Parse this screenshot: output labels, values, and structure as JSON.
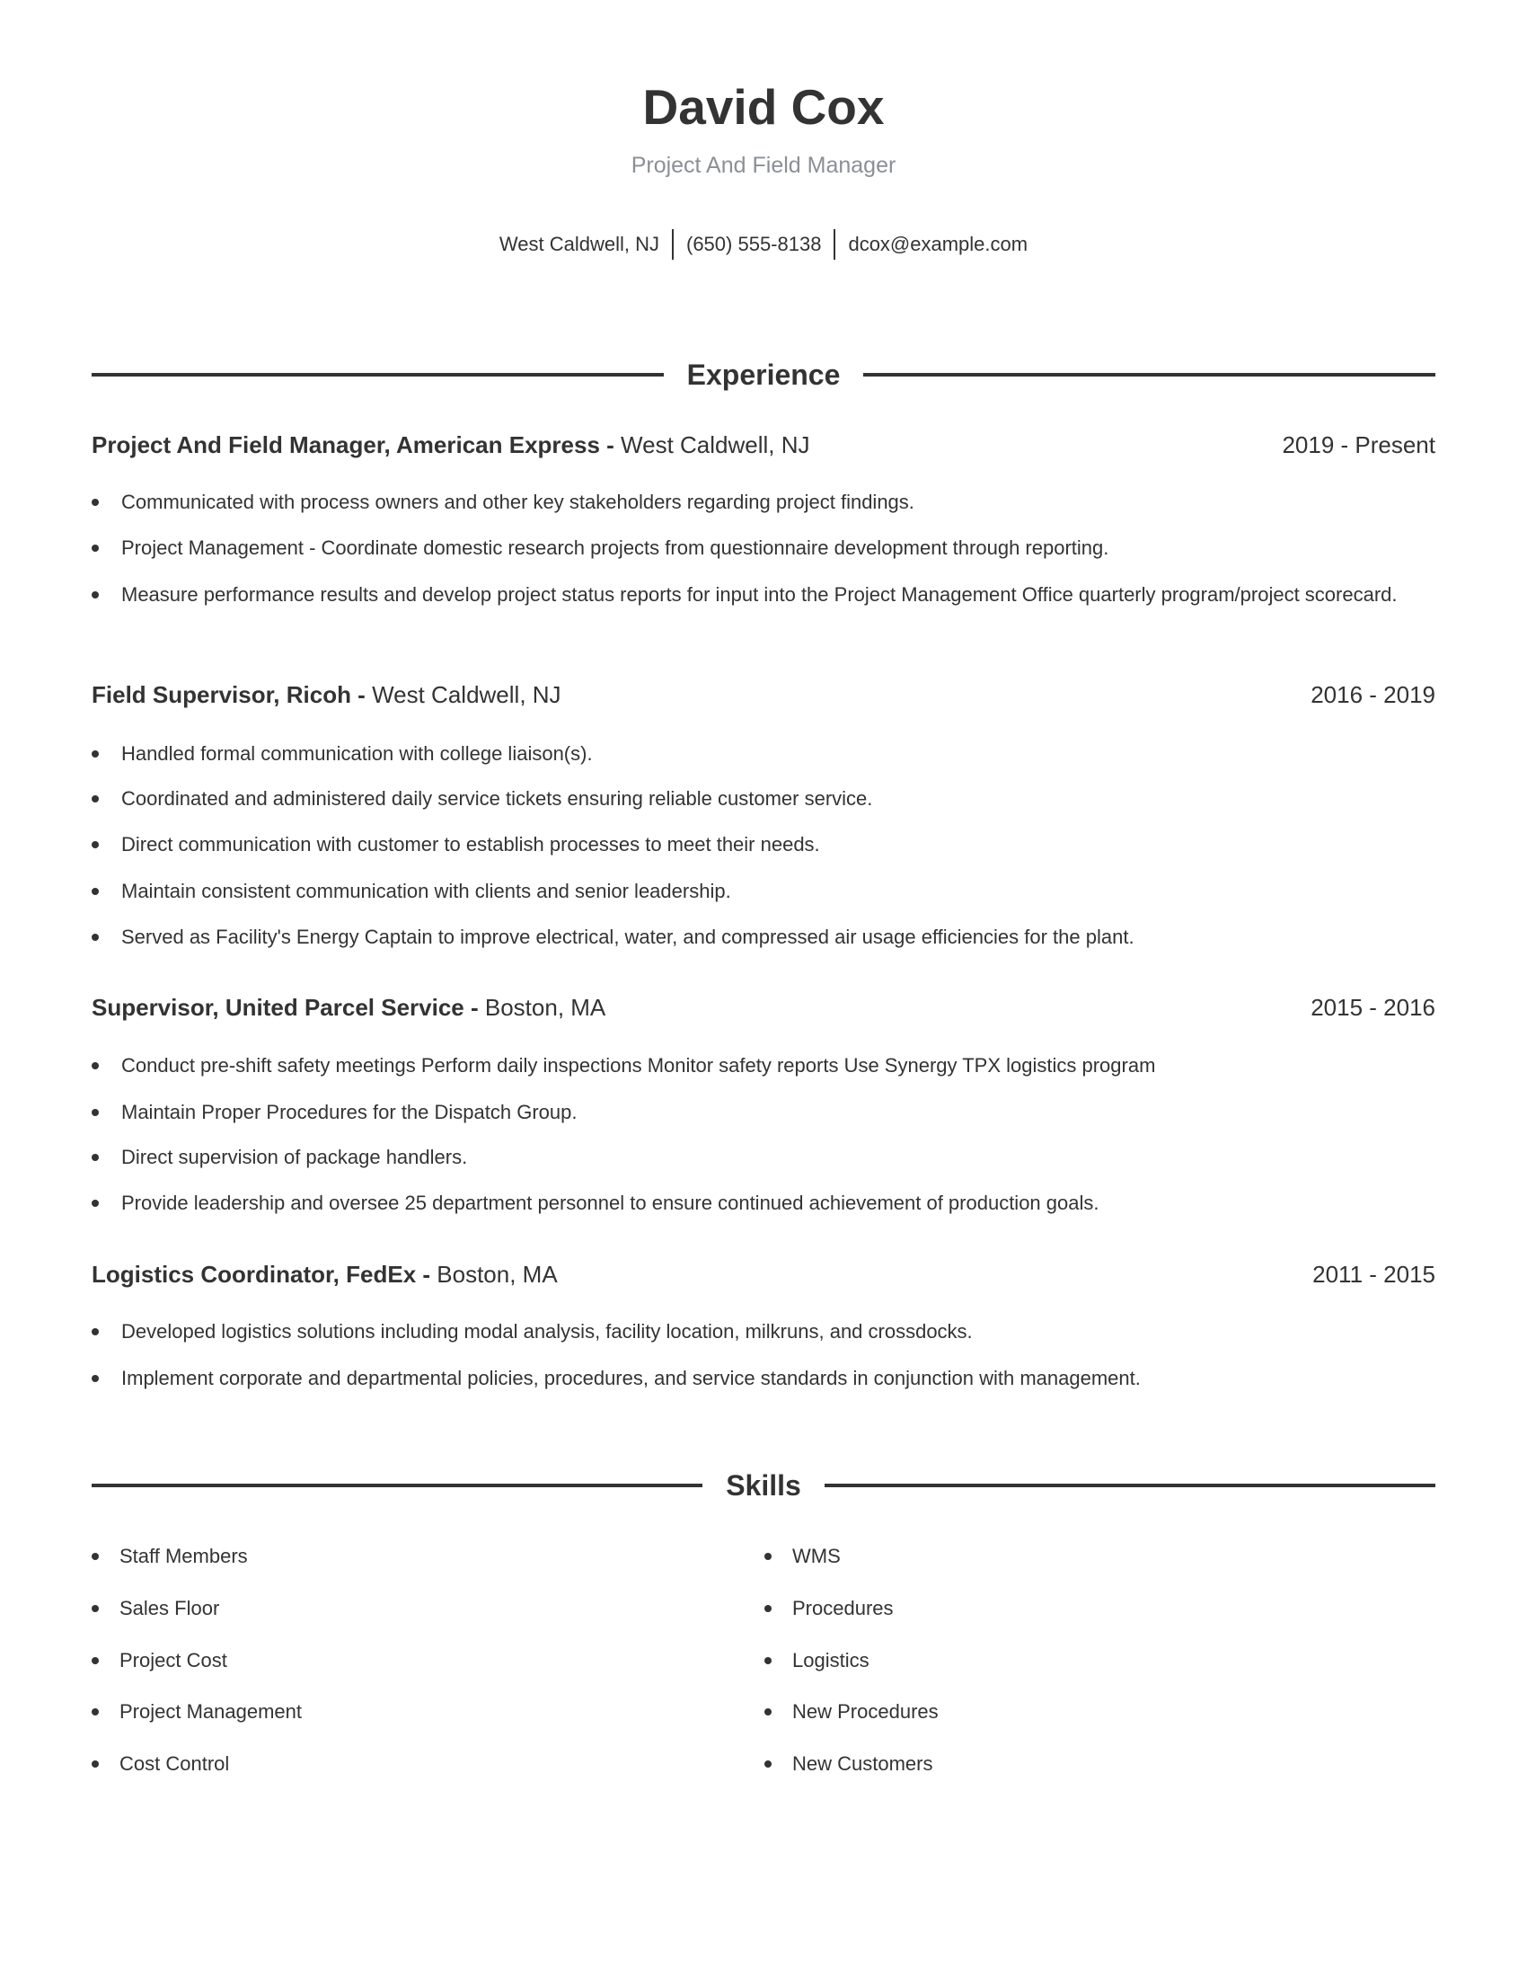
{
  "header": {
    "name": "David Cox",
    "title": "Project And Field Manager",
    "contact": {
      "location": "West Caldwell, NJ",
      "phone": "(650) 555-8138",
      "email": "dcox@example.com"
    }
  },
  "experience": {
    "heading": "Experience",
    "jobs": [
      {
        "title": "Project And Field Manager, American Express - ",
        "location": "West Caldwell, NJ",
        "dates": "2019 - Present",
        "bullets": [
          "Communicated with process owners and other key stakeholders regarding project findings.",
          "Project Management - Coordinate domestic research projects from questionnaire development through reporting.",
          "Measure performance results and develop project status reports for input into the Project Management Office quarterly program/project scorecard."
        ]
      },
      {
        "title": "Field Supervisor, Ricoh - ",
        "location": "West Caldwell, NJ",
        "dates": "2016 - 2019",
        "bullets": [
          "Handled formal communication with college liaison(s).",
          "Coordinated and administered daily service tickets ensuring reliable customer service.",
          "Direct communication with customer to establish processes to meet their needs.",
          "Maintain consistent communication with clients and senior leadership.",
          "Served as Facility's Energy Captain to improve electrical, water, and compressed air usage efficiencies for the plant."
        ]
      },
      {
        "title": "Supervisor, United Parcel Service - ",
        "location": "Boston, MA",
        "dates": "2015 - 2016",
        "bullets": [
          "Conduct pre-shift safety meetings Perform daily inspections Monitor safety reports Use Synergy TPX logistics program",
          "Maintain Proper Procedures for the Dispatch Group.",
          "Direct supervision of package handlers.",
          "Provide leadership and oversee 25 department personnel to ensure continued achievement of production goals."
        ]
      },
      {
        "title": "Logistics Coordinator, FedEx - ",
        "location": "Boston, MA",
        "dates": "2011 - 2015",
        "bullets": [
          "Developed logistics solutions including modal analysis, facility location, milkruns, and crossdocks.",
          "Implement corporate and departmental policies, procedures, and service standards in conjunction with management."
        ]
      }
    ]
  },
  "skills": {
    "heading": "Skills",
    "left": [
      "Staff Members",
      "Sales Floor",
      "Project Cost",
      "Project Management",
      "Cost Control"
    ],
    "right": [
      "WMS",
      "Procedures",
      "Logistics",
      "New Procedures",
      "New Customers"
    ]
  },
  "colors": {
    "text": "#333333",
    "subtitle": "#8a9097",
    "rule": "#333333"
  }
}
